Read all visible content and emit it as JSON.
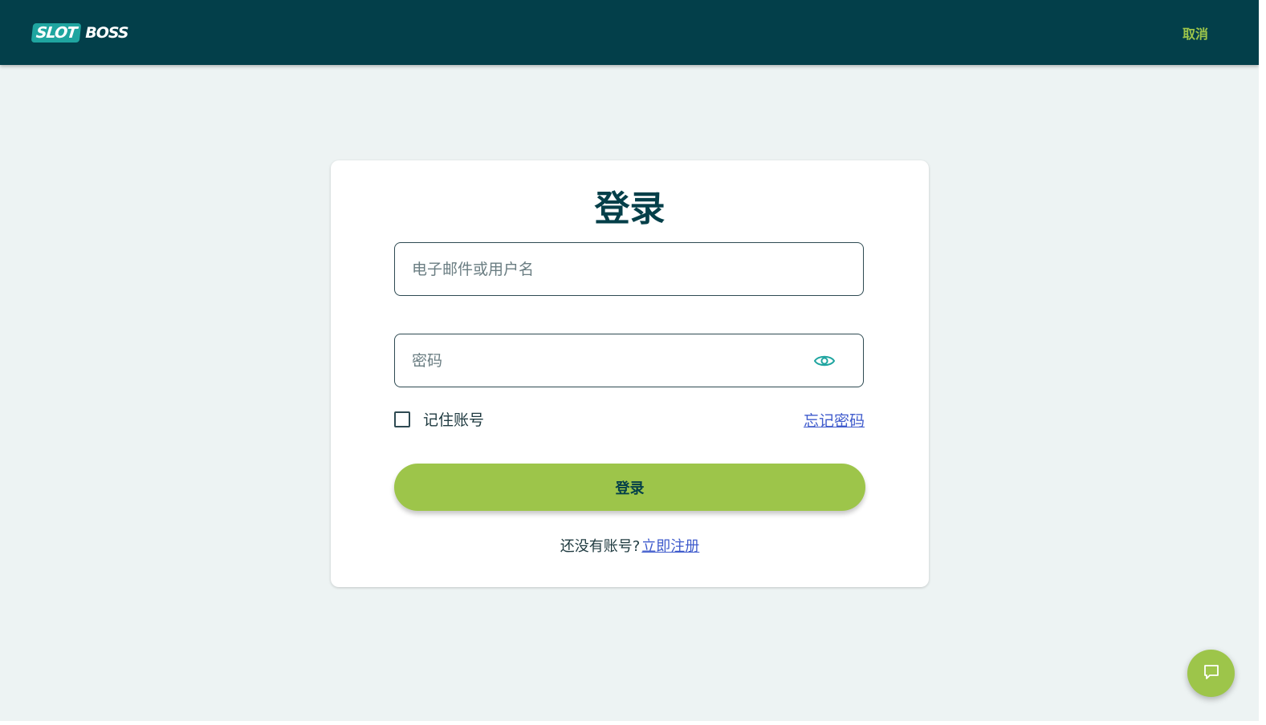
{
  "header": {
    "logo": {
      "part1": "SLOT",
      "part2": "BOSS"
    },
    "cancel_label": "取消"
  },
  "login": {
    "title": "登录",
    "email_placeholder": "电子邮件或用户名",
    "email_value": "",
    "password_placeholder": "密码",
    "password_value": "",
    "remember_label": "记住账号",
    "remember_checked": false,
    "forgot_label": "忘记密码",
    "submit_label": "登录",
    "no_account_text": "还没有账号?",
    "signup_label": "立即注册"
  },
  "icons": {
    "password_toggle": "eye-icon",
    "chat": "chat-bubble-icon"
  },
  "colors": {
    "header_bg": "#033f4a",
    "accent_green": "#9dc54a",
    "page_bg": "#edf3f3",
    "link_blue": "#3f5bcc",
    "logo_teal": "#1fa5a0"
  }
}
